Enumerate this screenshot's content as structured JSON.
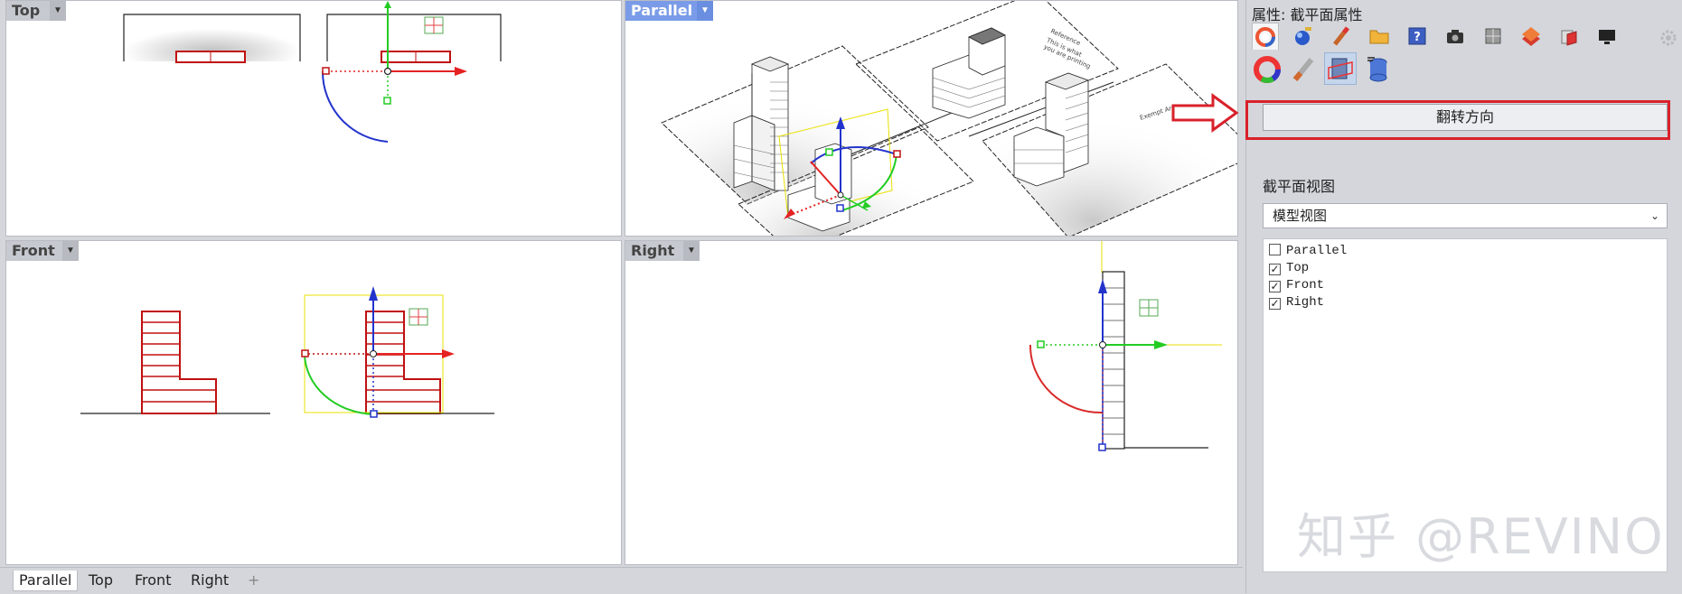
{
  "viewports": {
    "top": {
      "title": "Top"
    },
    "parallel": {
      "title": "Parallel"
    },
    "front": {
      "title": "Front"
    },
    "right": {
      "title": "Right"
    },
    "dropdown_glyph": "▼"
  },
  "scene_text": {
    "reference_note": [
      "Reference",
      "This is what",
      "you are printing"
    ],
    "exempt_note": "Exempt Area"
  },
  "tabs": [
    {
      "label": "Parallel",
      "active": true
    },
    {
      "label": "Top"
    },
    {
      "label": "Front"
    },
    {
      "label": "Right"
    },
    {
      "label": "+"
    }
  ],
  "panel": {
    "title": "属性: 截平面属性",
    "flip_button": "翻转方向",
    "section_label": "截平面视图",
    "view_select": {
      "value": "模型视图",
      "chevron": "⌄"
    },
    "view_list": [
      {
        "label": "Parallel",
        "checked": false
      },
      {
        "label": "Top",
        "checked": true
      },
      {
        "label": "Front",
        "checked": true
      },
      {
        "label": "Right",
        "checked": true
      }
    ],
    "check_glyph": "✓",
    "tab_icons": [
      "material-icon",
      "render-icon",
      "paint-icon",
      "folder-icon",
      "help-icon",
      "camera-icon",
      "grid-icon",
      "layer-icon",
      "decal-icon",
      "display-icon",
      "settings-icon"
    ],
    "sub_icons": [
      "color-wheel-icon",
      "brush-icon",
      "clipping-plane-icon",
      "database-icon"
    ]
  },
  "watermark": "知乎 @REVINO",
  "colors": {
    "accent": "#d9212b",
    "active_viewport": "#7a9ce8",
    "axis_x": "#e52222",
    "axis_y": "#22cc22",
    "axis_z": "#2233cc"
  }
}
